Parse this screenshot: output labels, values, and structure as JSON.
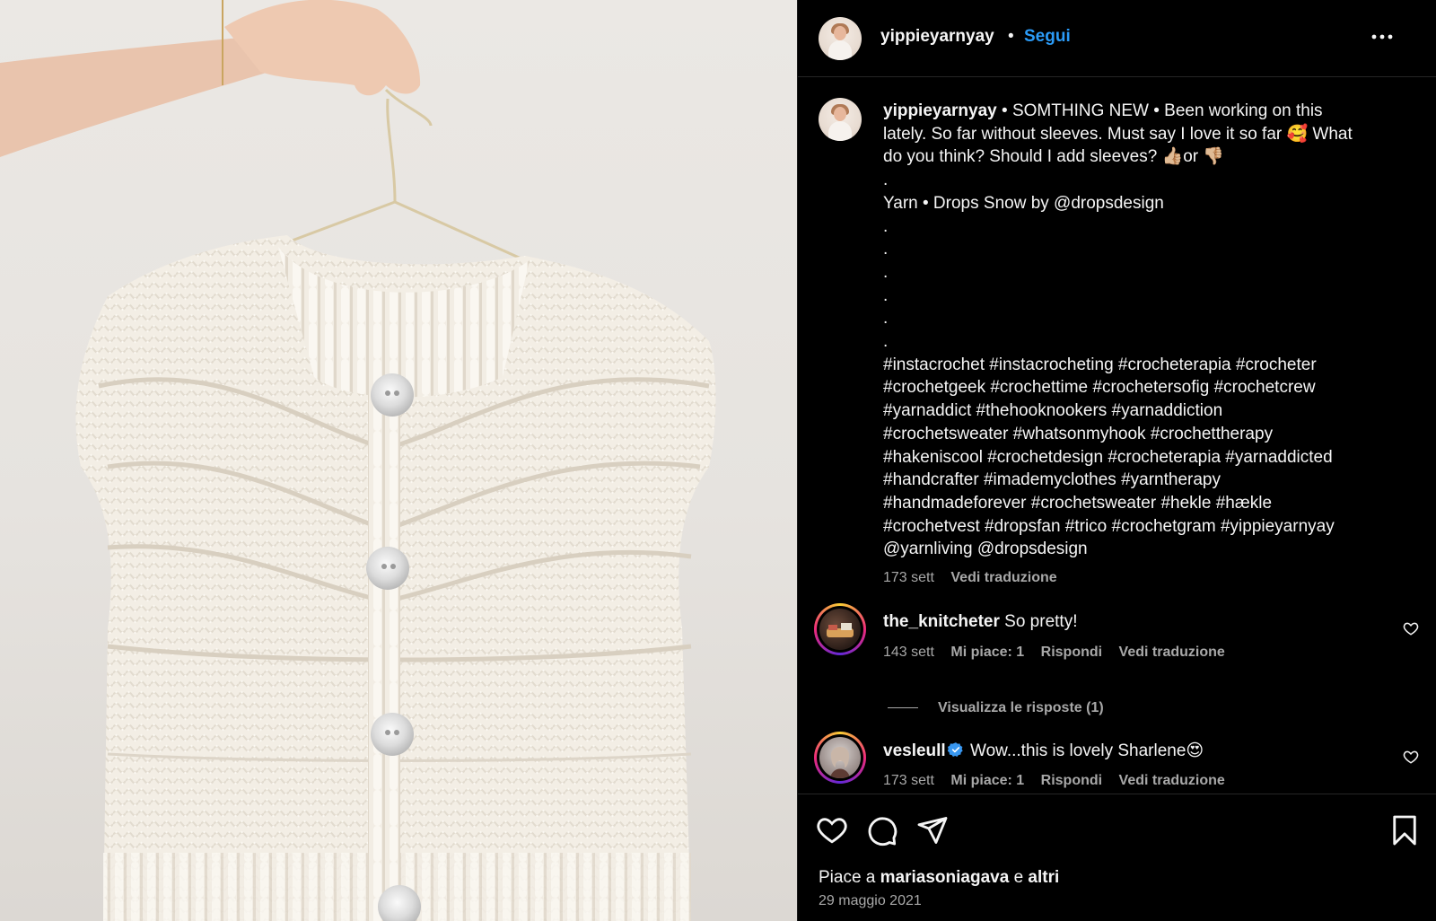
{
  "post": {
    "username": "yippieyarnyay",
    "dot": "•",
    "follow_label": "Segui",
    "more_icon": "more-horizontal-icon"
  },
  "caption": {
    "username": "yippieyarnyay",
    "lines": [
      " • SOMTHING NEW • Been working on this",
      "lately. So far without sleeves. Must say I love it so far 🥰 What",
      "do you think? Should I add sleeves? 👍🏼or 👎🏼",
      ".",
      "Yarn • Drops Snow by @dropsdesign",
      ".",
      ".",
      ".",
      ".",
      ".",
      ".",
      "#instacrochet #instacrocheting #crocheterapia #crocheter",
      "#crochetgeek #crochettime #crochetersofig #crochetcrew",
      "#yarnaddict #thehooknookers #yarnaddiction",
      "#crochetsweater #whatsonmyhook #crochettherapy",
      "#hakeniscool #crochetdesign #crocheterapia #yarnaddicted",
      "#handcrafter #imademyclothes #yarntherapy",
      "#handmadeforever #crochetsweater #hekle #hækle",
      "#crochetvest #dropsfan #trico #crochetgram #yippieyarnyay",
      "@yarnliving @dropsdesign"
    ],
    "age": "173 sett",
    "translate": "Vedi traduzione"
  },
  "comments": [
    {
      "username": "the_knitcheter",
      "text": "So pretty!",
      "age": "143 sett",
      "likes": "Mi piace: 1",
      "reply": "Rispondi",
      "translate": "Vedi traduzione"
    },
    {
      "username": "vesleull",
      "text": "Wow...this is lovely Sharlene😍",
      "age": "173 sett",
      "likes": "Mi piace: 1",
      "reply": "Rispondi",
      "translate": "Vedi traduzione"
    }
  ],
  "view_replies": "Visualizza le risposte (1)",
  "footer": {
    "likes_prefix": "Piace a ",
    "liked_by": "mariasoniagava",
    "likes_mid": " e ",
    "likes_others": "altri",
    "date": "29 maggio 2021"
  },
  "colors": {
    "accent": "#2b9bf7",
    "secondary_text": "#a8a8a8",
    "background": "#000000"
  }
}
